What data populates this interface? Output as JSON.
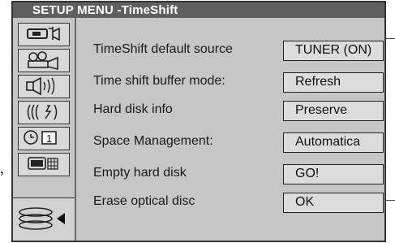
{
  "menu": {
    "title": "SETUP MENU -TimeShift"
  },
  "sidebar": {
    "items": [
      {
        "icon": "video-camera-icon"
      },
      {
        "icon": "film-projector-icon"
      },
      {
        "icon": "speaker-icon"
      },
      {
        "icon": "satellite-signal-icon"
      },
      {
        "icon": "clock-timer-icon",
        "badge": "1"
      },
      {
        "icon": "keypad-icon"
      },
      {
        "icon": "hard-disk-icon",
        "selected": true
      }
    ]
  },
  "settings": {
    "rows": [
      {
        "label": "TimeShift default source",
        "value": "TUNER (ON)"
      },
      {
        "label": "Time shift buffer mode:",
        "value": "Refresh"
      },
      {
        "label": "Hard disk info",
        "value": "Preserve"
      },
      {
        "label": "Space Management:",
        "value": "Automatica"
      },
      {
        "label": "Empty hard disk",
        "value": "GO!"
      },
      {
        "label": "Erase optical disc",
        "value": "OK"
      }
    ]
  },
  "stray": {
    "comma": ","
  }
}
